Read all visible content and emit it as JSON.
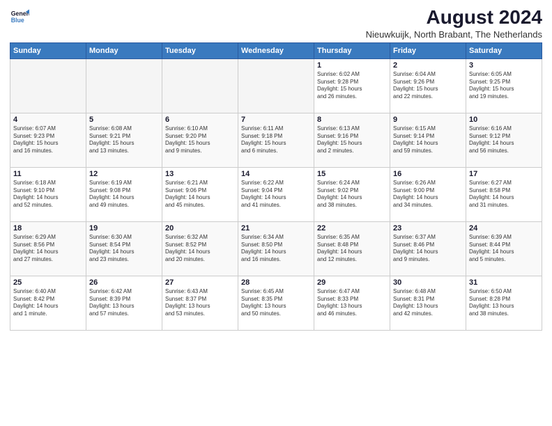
{
  "logo": {
    "line1": "General",
    "line2": "Blue"
  },
  "title": "August 2024",
  "subtitle": "Nieuwkuijk, North Brabant, The Netherlands",
  "weekdays": [
    "Sunday",
    "Monday",
    "Tuesday",
    "Wednesday",
    "Thursday",
    "Friday",
    "Saturday"
  ],
  "weeks": [
    [
      {
        "day": "",
        "info": ""
      },
      {
        "day": "",
        "info": ""
      },
      {
        "day": "",
        "info": ""
      },
      {
        "day": "",
        "info": ""
      },
      {
        "day": "1",
        "info": "Sunrise: 6:02 AM\nSunset: 9:28 PM\nDaylight: 15 hours\nand 26 minutes."
      },
      {
        "day": "2",
        "info": "Sunrise: 6:04 AM\nSunset: 9:26 PM\nDaylight: 15 hours\nand 22 minutes."
      },
      {
        "day": "3",
        "info": "Sunrise: 6:05 AM\nSunset: 9:25 PM\nDaylight: 15 hours\nand 19 minutes."
      }
    ],
    [
      {
        "day": "4",
        "info": "Sunrise: 6:07 AM\nSunset: 9:23 PM\nDaylight: 15 hours\nand 16 minutes."
      },
      {
        "day": "5",
        "info": "Sunrise: 6:08 AM\nSunset: 9:21 PM\nDaylight: 15 hours\nand 13 minutes."
      },
      {
        "day": "6",
        "info": "Sunrise: 6:10 AM\nSunset: 9:20 PM\nDaylight: 15 hours\nand 9 minutes."
      },
      {
        "day": "7",
        "info": "Sunrise: 6:11 AM\nSunset: 9:18 PM\nDaylight: 15 hours\nand 6 minutes."
      },
      {
        "day": "8",
        "info": "Sunrise: 6:13 AM\nSunset: 9:16 PM\nDaylight: 15 hours\nand 2 minutes."
      },
      {
        "day": "9",
        "info": "Sunrise: 6:15 AM\nSunset: 9:14 PM\nDaylight: 14 hours\nand 59 minutes."
      },
      {
        "day": "10",
        "info": "Sunrise: 6:16 AM\nSunset: 9:12 PM\nDaylight: 14 hours\nand 56 minutes."
      }
    ],
    [
      {
        "day": "11",
        "info": "Sunrise: 6:18 AM\nSunset: 9:10 PM\nDaylight: 14 hours\nand 52 minutes."
      },
      {
        "day": "12",
        "info": "Sunrise: 6:19 AM\nSunset: 9:08 PM\nDaylight: 14 hours\nand 49 minutes."
      },
      {
        "day": "13",
        "info": "Sunrise: 6:21 AM\nSunset: 9:06 PM\nDaylight: 14 hours\nand 45 minutes."
      },
      {
        "day": "14",
        "info": "Sunrise: 6:22 AM\nSunset: 9:04 PM\nDaylight: 14 hours\nand 41 minutes."
      },
      {
        "day": "15",
        "info": "Sunrise: 6:24 AM\nSunset: 9:02 PM\nDaylight: 14 hours\nand 38 minutes."
      },
      {
        "day": "16",
        "info": "Sunrise: 6:26 AM\nSunset: 9:00 PM\nDaylight: 14 hours\nand 34 minutes."
      },
      {
        "day": "17",
        "info": "Sunrise: 6:27 AM\nSunset: 8:58 PM\nDaylight: 14 hours\nand 31 minutes."
      }
    ],
    [
      {
        "day": "18",
        "info": "Sunrise: 6:29 AM\nSunset: 8:56 PM\nDaylight: 14 hours\nand 27 minutes."
      },
      {
        "day": "19",
        "info": "Sunrise: 6:30 AM\nSunset: 8:54 PM\nDaylight: 14 hours\nand 23 minutes."
      },
      {
        "day": "20",
        "info": "Sunrise: 6:32 AM\nSunset: 8:52 PM\nDaylight: 14 hours\nand 20 minutes."
      },
      {
        "day": "21",
        "info": "Sunrise: 6:34 AM\nSunset: 8:50 PM\nDaylight: 14 hours\nand 16 minutes."
      },
      {
        "day": "22",
        "info": "Sunrise: 6:35 AM\nSunset: 8:48 PM\nDaylight: 14 hours\nand 12 minutes."
      },
      {
        "day": "23",
        "info": "Sunrise: 6:37 AM\nSunset: 8:46 PM\nDaylight: 14 hours\nand 9 minutes."
      },
      {
        "day": "24",
        "info": "Sunrise: 6:39 AM\nSunset: 8:44 PM\nDaylight: 14 hours\nand 5 minutes."
      }
    ],
    [
      {
        "day": "25",
        "info": "Sunrise: 6:40 AM\nSunset: 8:42 PM\nDaylight: 14 hours\nand 1 minute."
      },
      {
        "day": "26",
        "info": "Sunrise: 6:42 AM\nSunset: 8:39 PM\nDaylight: 13 hours\nand 57 minutes."
      },
      {
        "day": "27",
        "info": "Sunrise: 6:43 AM\nSunset: 8:37 PM\nDaylight: 13 hours\nand 53 minutes."
      },
      {
        "day": "28",
        "info": "Sunrise: 6:45 AM\nSunset: 8:35 PM\nDaylight: 13 hours\nand 50 minutes."
      },
      {
        "day": "29",
        "info": "Sunrise: 6:47 AM\nSunset: 8:33 PM\nDaylight: 13 hours\nand 46 minutes."
      },
      {
        "day": "30",
        "info": "Sunrise: 6:48 AM\nSunset: 8:31 PM\nDaylight: 13 hours\nand 42 minutes."
      },
      {
        "day": "31",
        "info": "Sunrise: 6:50 AM\nSunset: 8:28 PM\nDaylight: 13 hours\nand 38 minutes."
      }
    ]
  ]
}
